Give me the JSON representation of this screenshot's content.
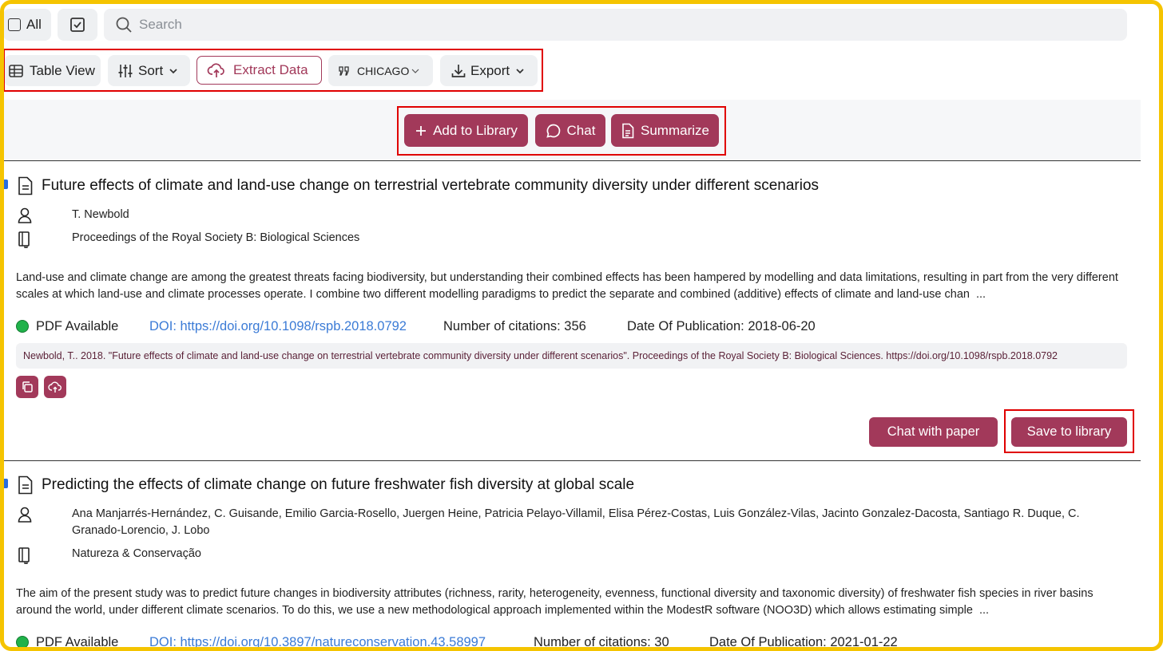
{
  "toolbar": {
    "all_label": "All",
    "search_placeholder": "Search",
    "table_view_label": "Table View",
    "sort_label": "Sort",
    "extract_label": "Extract Data",
    "citation_style": "CHICAGO",
    "export_label": "Export"
  },
  "actions": {
    "add_library": "Add to Library",
    "chat": "Chat",
    "summarize": "Summarize"
  },
  "papers": [
    {
      "title": "Future effects of climate and land-use change on terrestrial vertebrate community diversity under different scenarios",
      "authors": "T. Newbold",
      "journal": "Proceedings of the Royal Society B: Biological Sciences",
      "abstract": "Land-use and climate change are among the greatest threats facing biodiversity, but understanding their combined effects has been hampered by modelling and data limitations, resulting in part from the very different scales at which land-use and climate processes operate. I combine two different modelling paradigms to predict the separate and combined (additive) effects of climate and land-use chan",
      "ellipsis": "...",
      "pdf": "PDF Available",
      "doi": "DOI: https://doi.org/10.1098/rspb.2018.0792",
      "citations": "Number of citations: 356",
      "date": "Date Of Publication: 2018-06-20",
      "citation_text": "Newbold, T.. 2018. \"Future effects of climate and land-use change on terrestrial vertebrate community diversity under different scenarios\". Proceedings of the Royal Society B: Biological Sciences. https://doi.org/10.1098/rspb.2018.0792",
      "chat_label": "Chat with paper",
      "save_label": "Save to library"
    },
    {
      "title": "Predicting the effects of climate change on future freshwater fish diversity at global scale",
      "authors": "Ana Manjarrés-Hernández, C. Guisande, Emilio Garcia-Rosello, Juergen Heine, Patricia Pelayo-Villamil, Elisa Pérez-Costas, Luis González-Vilas, Jacinto Gonzalez-Dacosta, Santiago R. Duque, C. Granado-Lorencio, J. Lobo",
      "journal": "Natureza & Conservação",
      "abstract": "The aim of the present study was to predict future changes in biodiversity attributes (richness, rarity, heterogeneity, evenness, functional diversity and taxonomic diversity) of freshwater fish species in river basins around the world, under different climate scenarios. To do this, we use a new methodological approach implemented within the ModestR software (NOO3D) which allows estimating simple",
      "ellipsis": "...",
      "pdf": "PDF Available",
      "doi": "DOI: https://doi.org/10.3897/natureconservation.43.58997",
      "citations": "Number of citations: 30",
      "date": "Date Of Publication: 2021-01-22"
    }
  ],
  "colors": {
    "accent": "#a2395a",
    "pdf_dot": "#20b24a",
    "link": "#3b7bd6",
    "frame": "#f5c400",
    "highlight": "#e00000"
  }
}
